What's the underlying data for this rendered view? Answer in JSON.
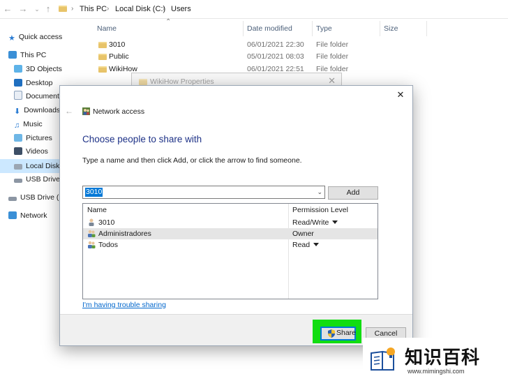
{
  "explorer": {
    "breadcrumb": [
      "This PC",
      "Local Disk (C:)",
      "Users"
    ],
    "sidebar": [
      {
        "label": "Quick access",
        "icon": "star-icon"
      },
      {
        "label": "This PC",
        "icon": "computer-icon"
      },
      {
        "label": "3D Objects",
        "icon": "cube-icon"
      },
      {
        "label": "Desktop",
        "icon": "desktop-icon"
      },
      {
        "label": "Documents",
        "icon": "document-icon"
      },
      {
        "label": "Downloads",
        "icon": "download-icon"
      },
      {
        "label": "Music",
        "icon": "music-icon"
      },
      {
        "label": "Pictures",
        "icon": "picture-icon"
      },
      {
        "label": "Videos",
        "icon": "video-icon"
      },
      {
        "label": "Local Disk (",
        "icon": "drive-icon"
      },
      {
        "label": "USB Drive (",
        "icon": "usb-drive-icon"
      },
      {
        "label": "USB Drive (D",
        "icon": "usb-drive-icon"
      },
      {
        "label": "Network",
        "icon": "network-icon"
      }
    ],
    "columns": {
      "name": "Name",
      "date": "Date modified",
      "type": "Type",
      "size": "Size"
    },
    "files": [
      {
        "name": "3010",
        "date": "06/01/2021 22:30",
        "type": "File folder"
      },
      {
        "name": "Public",
        "date": "05/01/2021 08:03",
        "type": "File folder"
      },
      {
        "name": "WikiHow",
        "date": "06/01/2021 22:51",
        "type": "File folder"
      }
    ]
  },
  "back_window": {
    "title": "WikiHow Properties"
  },
  "dialog": {
    "title": "Network access",
    "heading": "Choose people to share with",
    "instruction": "Type a name and then click Add, or click the arrow to find someone.",
    "input_value": "3010",
    "add_label": "Add",
    "list_headers": {
      "name": "Name",
      "permission": "Permission Level"
    },
    "people": [
      {
        "name": "3010",
        "permission": "Read/Write",
        "dropdown": true
      },
      {
        "name": "Administradores",
        "permission": "Owner",
        "dropdown": false
      },
      {
        "name": "Todos",
        "permission": "Read",
        "dropdown": true
      }
    ],
    "trouble_link": "I'm having trouble sharing",
    "share_label": "Share",
    "cancel_label": "Cancel"
  },
  "watermark": {
    "text_cn": "知识百科",
    "url": "www.mimingshi.com"
  },
  "colors": {
    "accent": "#0066cc",
    "heading": "#1e3287",
    "highlight": "#11dd11"
  }
}
